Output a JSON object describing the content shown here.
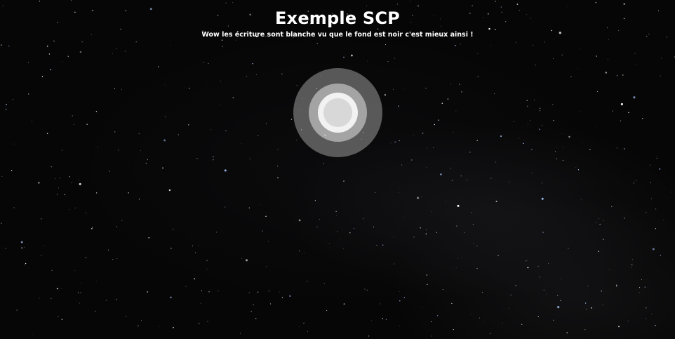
{
  "header": {
    "title": "Exemple SCP",
    "subtitle": "Wow les écriture sont blanche vu que le fond est noir c'est mieux ainsi !"
  },
  "colors": {
    "background": "#060606",
    "text": "#ffffff",
    "target_outer": "#c8c8c8",
    "target_core": "#d8d8d8"
  },
  "icons": {
    "center": "concentric-circles-icon"
  }
}
